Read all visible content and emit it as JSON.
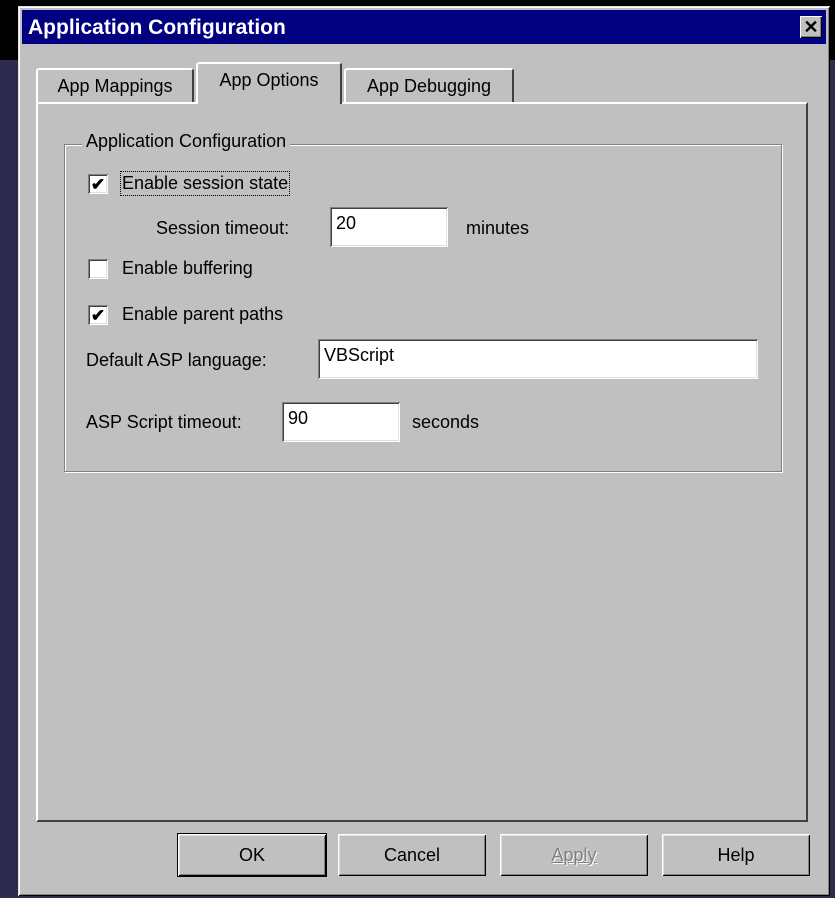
{
  "window": {
    "title": "Application Configuration",
    "close_glyph": "✕"
  },
  "tabs": [
    {
      "label": "App Mappings",
      "active": false
    },
    {
      "label": "App Options",
      "active": true
    },
    {
      "label": "App Debugging",
      "active": false
    }
  ],
  "group": {
    "legend": "Application Configuration"
  },
  "options": {
    "session_state": {
      "label": "Enable session state",
      "checked": true
    },
    "session_timeout": {
      "label": "Session timeout:",
      "value": "20",
      "unit": "minutes"
    },
    "buffering": {
      "label": "Enable buffering",
      "checked": false
    },
    "parent_paths": {
      "label": "Enable parent paths",
      "checked": true
    },
    "asp_language": {
      "label": "Default ASP language:",
      "value": "VBScript"
    },
    "script_timeout": {
      "label": "ASP Script timeout:",
      "value": "90",
      "unit": "seconds"
    }
  },
  "buttons": {
    "ok": "OK",
    "cancel": "Cancel",
    "apply": "Apply",
    "help": "Help"
  },
  "icons": {
    "check": "✔"
  }
}
